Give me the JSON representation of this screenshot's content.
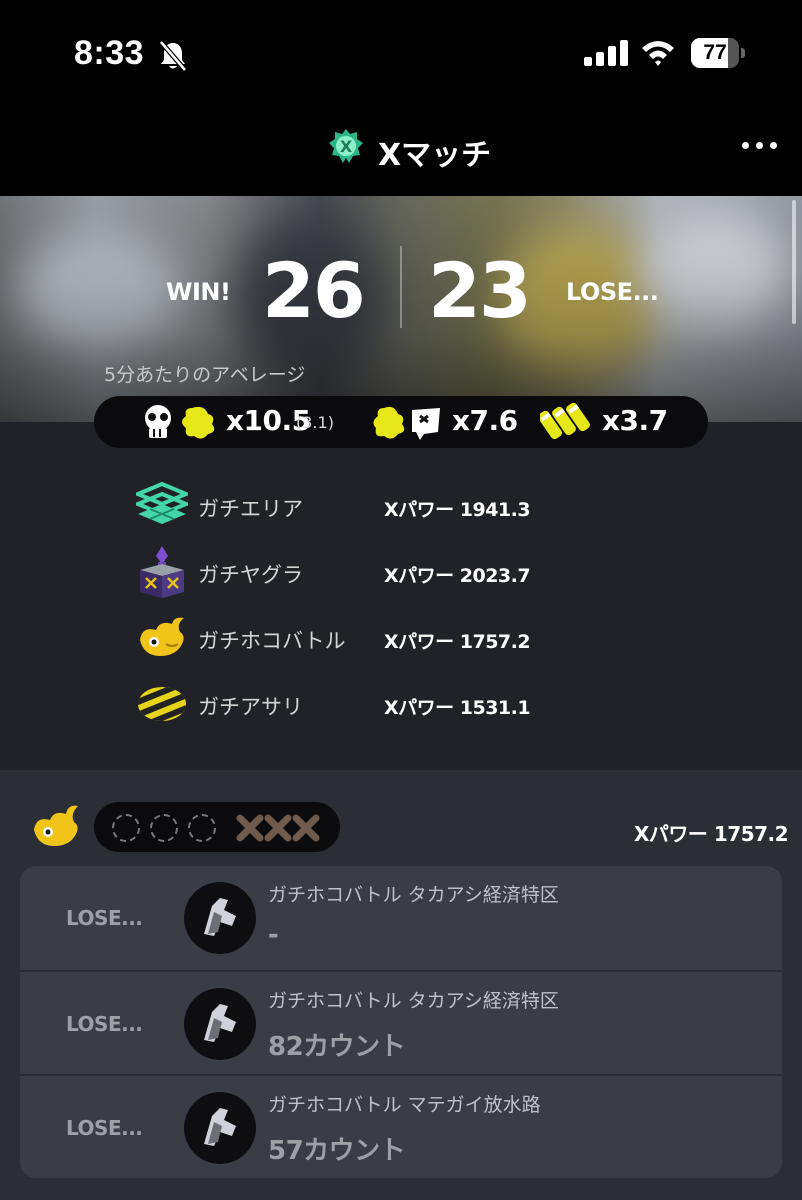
{
  "status_bar": {
    "time": "8:33",
    "battery": "77",
    "battery_percent": 77,
    "icons": [
      "bell-slash-icon",
      "signal-icon",
      "wifi-icon",
      "battery-icon"
    ]
  },
  "nav": {
    "title": "Xマッチ",
    "icon": "x-match-icon",
    "more_icon": "more-horizontal-icon"
  },
  "result": {
    "win_label": "WIN!",
    "win_count": "26",
    "lose_count": "23",
    "lose_label": "LOSE..."
  },
  "average": {
    "label": "5分あたりのアベレージ",
    "kills": "x10.5",
    "assists": "(3.1)",
    "deaths": "x7.6",
    "specials": "x3.7",
    "icons": [
      "kill-icon",
      "death-icon",
      "special-icon"
    ]
  },
  "modes": [
    {
      "name": "ガチエリア",
      "power": "Xパワー 1941.3",
      "icon": "splat-zones-icon"
    },
    {
      "name": "ガチヤグラ",
      "power": "Xパワー 2023.7",
      "icon": "tower-control-icon"
    },
    {
      "name": "ガチホコバトル",
      "power": "Xパワー 1757.2",
      "icon": "rainmaker-icon"
    },
    {
      "name": "ガチアサリ",
      "power": "Xパワー 1531.1",
      "icon": "clam-blitz-icon"
    }
  ],
  "series": {
    "mode_icon": "rainmaker-icon",
    "power": "Xパワー 1757.2",
    "wins": 0,
    "losses": 3,
    "slots": [
      "empty",
      "empty",
      "empty",
      "loss",
      "loss",
      "loss"
    ]
  },
  "battles": [
    {
      "result": "LOSE...",
      "stage": "ガチホコバトル タカアシ経済特区",
      "stat": "-",
      "weapon_icon": "weapon-icon"
    },
    {
      "result": "LOSE...",
      "stage": "ガチホコバトル タカアシ経済特区",
      "stat": "82カウント",
      "weapon_icon": "weapon-icon"
    },
    {
      "result": "LOSE...",
      "stage": "ガチホコバトル マテガイ放水路",
      "stat": "57カウント",
      "weapon_icon": "weapon-icon"
    }
  ],
  "colors": {
    "background": "#202228",
    "accent_yellow": "#e6e619",
    "zones_teal": "#45d6a8",
    "tower_purple": "#6b3fb5",
    "rainmaker_gold": "#f0c419"
  }
}
